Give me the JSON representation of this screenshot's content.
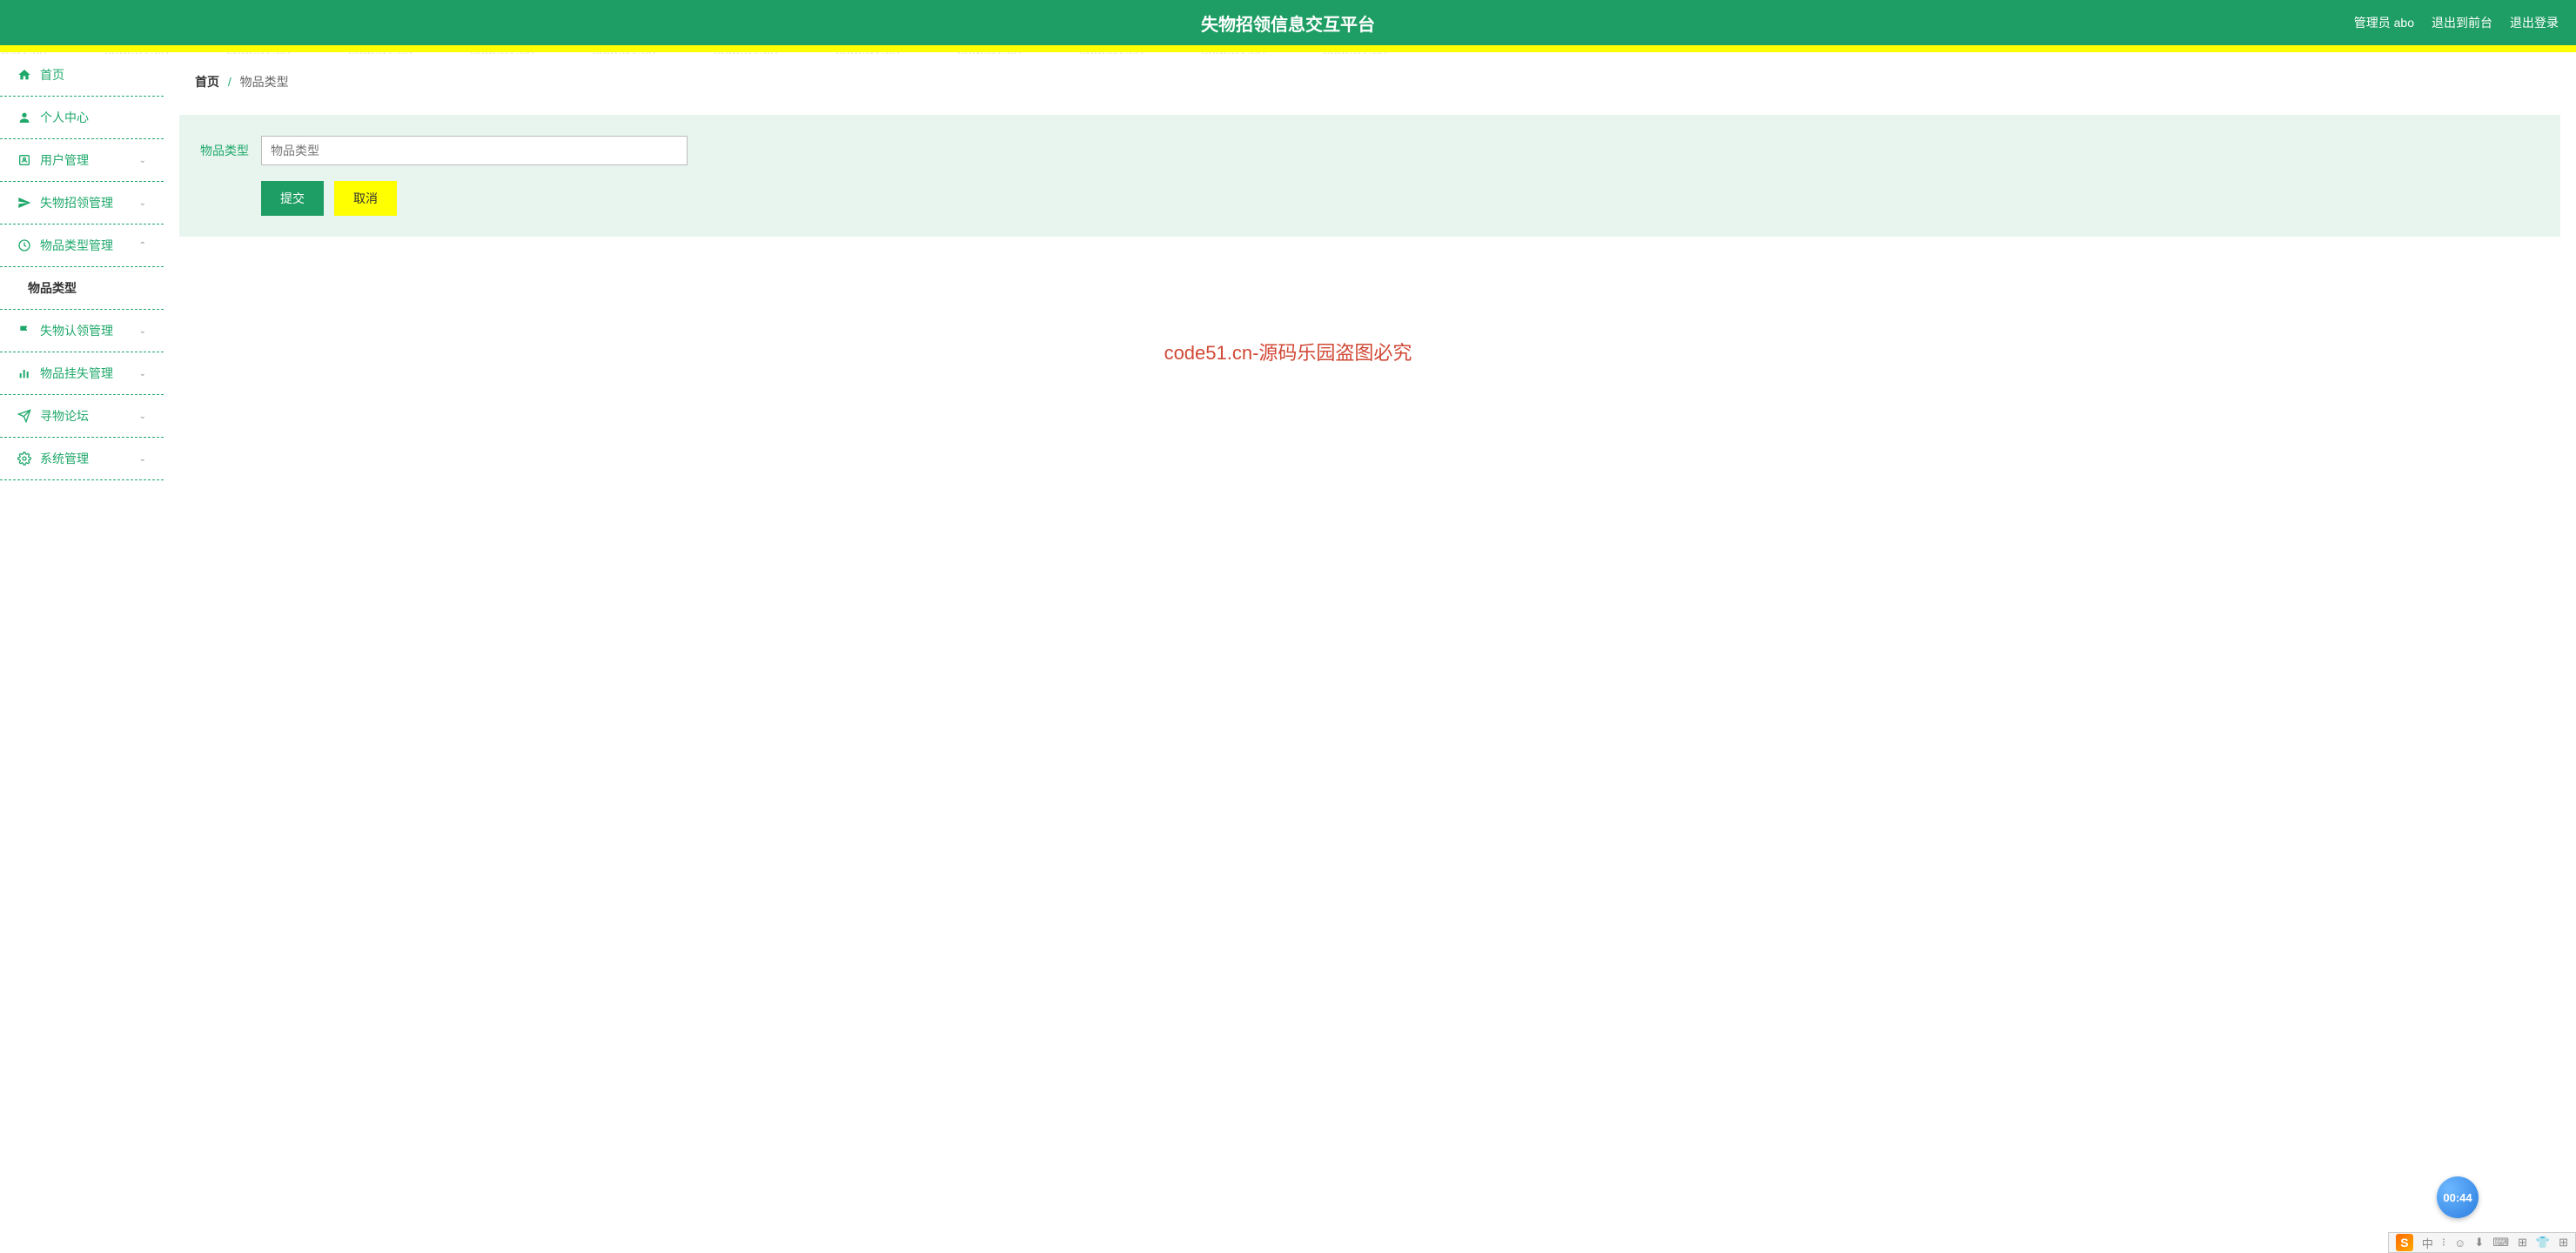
{
  "header": {
    "title": "失物招领信息交互平台",
    "admin_label": "管理员 abo",
    "exit_front": "退出到前台",
    "logout": "退出登录"
  },
  "sidebar": {
    "items": [
      {
        "label": "首页",
        "icon": "home"
      },
      {
        "label": "个人中心",
        "icon": "user"
      },
      {
        "label": "用户管理",
        "icon": "user-manage",
        "expandable": true
      },
      {
        "label": "失物招领管理",
        "icon": "paper-plane",
        "expandable": true
      },
      {
        "label": "物品类型管理",
        "icon": "clock",
        "expandable": true,
        "expanded": true
      },
      {
        "label": "失物认领管理",
        "icon": "flag",
        "expandable": true
      },
      {
        "label": "物品挂失管理",
        "icon": "chart",
        "expandable": true
      },
      {
        "label": "寻物论坛",
        "icon": "send"
      },
      {
        "label": "系统管理",
        "icon": "gear",
        "expandable": true
      }
    ],
    "subitem_label": "物品类型"
  },
  "breadcrumb": {
    "home": "首页",
    "separator": "/",
    "current": "物品类型"
  },
  "form": {
    "field_label": "物品类型",
    "field_placeholder": "物品类型",
    "submit_label": "提交",
    "cancel_label": "取消"
  },
  "watermark": {
    "text": "code51.cn",
    "center_text": "code51.cn-源码乐园盗图必究"
  },
  "float_badge": "00:44",
  "ime": {
    "logo": "S",
    "lang": "中",
    "items": [
      "⁝",
      "☺",
      "⬇",
      "⌨",
      "⊞",
      "👕",
      "⊞"
    ]
  }
}
